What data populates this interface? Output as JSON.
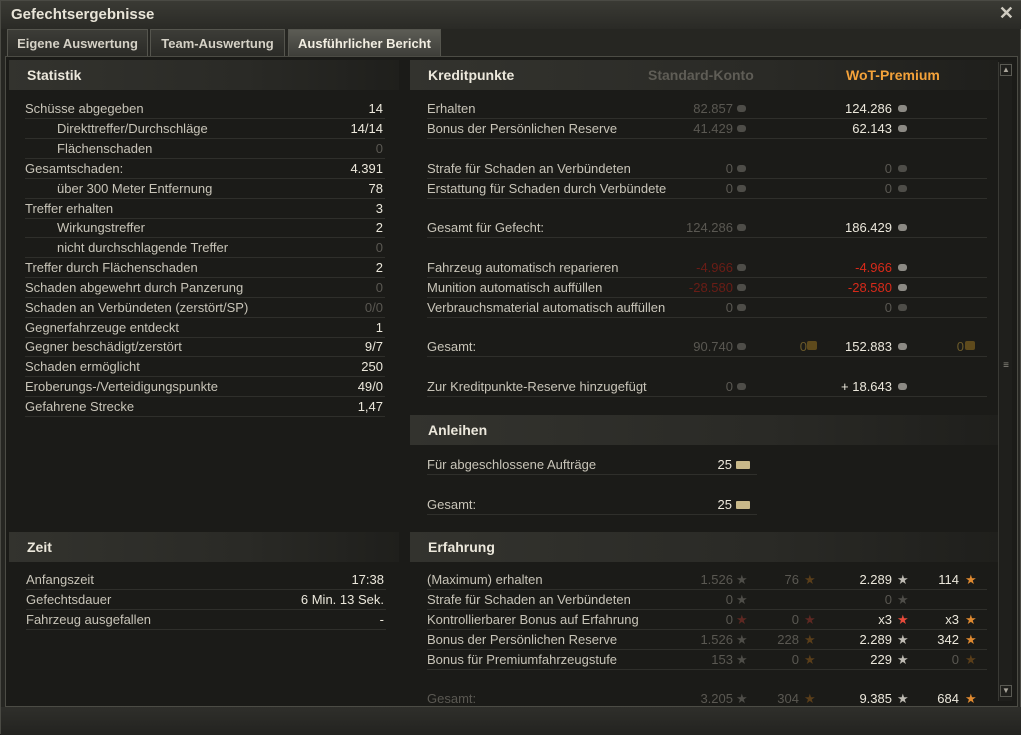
{
  "window": {
    "title": "Gefechtsergebnisse",
    "close": "✕"
  },
  "tabs": [
    "Eigene Auswertung",
    "Team-Auswertung",
    "Ausführlicher Bericht"
  ],
  "statistik": {
    "title": "Statistik",
    "rows": [
      {
        "label": "Schüsse abgegeben",
        "value": "14"
      },
      {
        "label": "Direkttreffer/Durchschläge",
        "value": "14/14"
      },
      {
        "label": "Flächenschaden",
        "value": "0"
      },
      {
        "label": "Gesamtschaden:",
        "value": "4.391"
      },
      {
        "label": "über 300 Meter Entfernung",
        "value": "78"
      },
      {
        "label": "Treffer erhalten",
        "value": "3"
      },
      {
        "label": "Wirkungstreffer",
        "value": "2"
      },
      {
        "label": "nicht durchschlagende Treffer",
        "value": "0"
      },
      {
        "label": "Treffer durch Flächenschaden",
        "value": "2"
      },
      {
        "label": "Schaden abgewehrt durch Panzerung",
        "value": "0"
      },
      {
        "label": "Schaden an Verbündeten (zerstört/SP)",
        "value": "0/0"
      },
      {
        "label": "Gegnerfahrzeuge entdeckt",
        "value": "1"
      },
      {
        "label": "Gegner beschädigt/zerstört",
        "value": "9/7"
      },
      {
        "label": "Schaden ermöglicht",
        "value": "250"
      },
      {
        "label": "Eroberungs-/Verteidigungspunkte",
        "value": "49/0"
      },
      {
        "label": "Gefahrene Strecke",
        "value": "1,47"
      }
    ]
  },
  "zeit": {
    "title": "Zeit",
    "rows": [
      {
        "label": "Anfangszeit",
        "value": "17:38"
      },
      {
        "label": "Gefechtsdauer",
        "value": "6 Min. 13 Sek."
      },
      {
        "label": "Fahrzeug ausgefallen",
        "value": "-"
      }
    ]
  },
  "kredit": {
    "title": "Kreditpunkte",
    "col_standard": "Standard-Konto",
    "col_premium": "WoT-Premium",
    "rows": [
      {
        "label": "Erhalten",
        "std": "82.857",
        "prem": "124.286"
      },
      {
        "label": "Bonus der Persönlichen Reserve",
        "std": "41.429",
        "prem": "62.143"
      },
      {
        "label": "Strafe für Schaden an Verbündeten",
        "std": "0",
        "prem": "0"
      },
      {
        "label": "Erstattung für Schaden durch Verbündete",
        "std": "0",
        "prem": "0"
      },
      {
        "label": "Gesamt für Gefecht:",
        "std": "124.286",
        "prem": "186.429"
      },
      {
        "label": "Fahrzeug automatisch reparieren",
        "std": "-4.966",
        "prem": "-4.966"
      },
      {
        "label": "Munition automatisch auffüllen",
        "std": "-28.580",
        "prem": "-28.580"
      },
      {
        "label": "Verbrauchsmaterial automatisch auffüllen",
        "std": "0",
        "prem": "0"
      },
      {
        "label": "Gesamt:",
        "std": "90.740",
        "std_gold": "0",
        "prem": "152.883",
        "prem_gold": "0"
      },
      {
        "label": "Zur Kreditpunkte-Reserve hinzugefügt",
        "std": "0",
        "prem": "+ 18.643"
      }
    ]
  },
  "anleihen": {
    "title": "Anleihen",
    "rows": [
      {
        "label": "Für abgeschlossene Aufträge",
        "value": "25"
      },
      {
        "label": "Gesamt:",
        "value": "25"
      }
    ]
  },
  "erfahrung": {
    "title": "Erfahrung",
    "rows": [
      {
        "label": "(Maximum) erhalten",
        "std_xp": "1.526",
        "std_fxp": "76",
        "prem_xp": "2.289",
        "prem_fxp": "114"
      },
      {
        "label": "Strafe für Schaden an Verbündeten",
        "std_xp": "0",
        "prem_xp": "0"
      },
      {
        "label": "Kontrollierbarer Bonus auf Erfahrung",
        "std_xp": "0",
        "std_fxp": "0",
        "prem_xp": "x3",
        "prem_fxp": "x3"
      },
      {
        "label": "Bonus der Persönlichen Reserve",
        "std_xp": "1.526",
        "std_fxp": "228",
        "prem_xp": "2.289",
        "prem_fxp": "342"
      },
      {
        "label": "Bonus für Premiumfahrzeugstufe",
        "std_xp": "153",
        "std_fxp": "0",
        "prem_xp": "229",
        "prem_fxp": "0"
      },
      {
        "label": "Gesamt:",
        "std_xp": "3.205",
        "std_fxp": "304",
        "prem_xp": "9.385",
        "prem_fxp": "684"
      }
    ]
  },
  "icons": {
    "credit": "credit-icon",
    "gold": "gold-icon",
    "bond": "bond-icon",
    "xp": "xp-star-icon",
    "free_xp": "free-xp-star-icon"
  }
}
